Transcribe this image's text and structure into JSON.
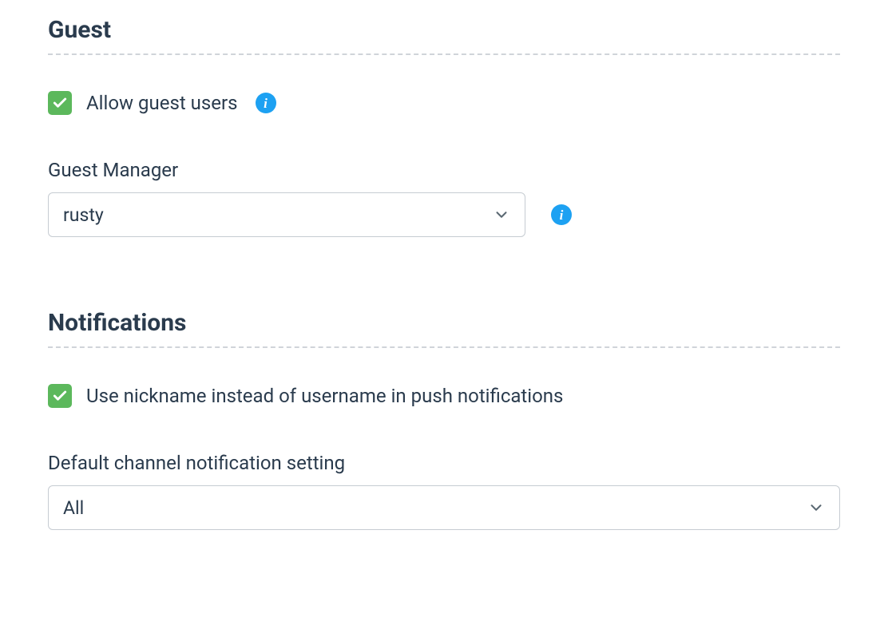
{
  "guest": {
    "title": "Guest",
    "allow_label": "Allow guest users",
    "allow_checked": true,
    "manager_label": "Guest Manager",
    "manager_value": "rusty"
  },
  "notifications": {
    "title": "Notifications",
    "nickname_label": "Use nickname instead of username in push notifications",
    "nickname_checked": true,
    "default_channel_label": "Default channel notification setting",
    "default_channel_value": "All"
  }
}
